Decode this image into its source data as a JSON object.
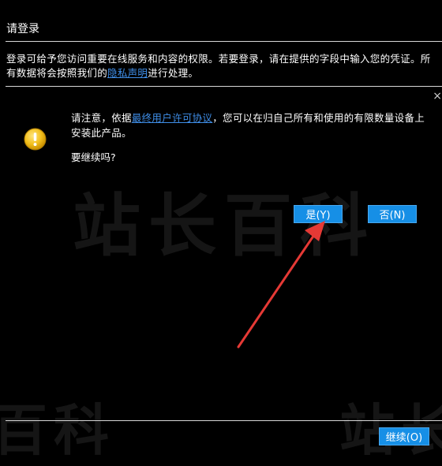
{
  "window": {
    "title": "请登录"
  },
  "intro": {
    "text_before": "登录可给予您访问重要在线服务和内容的权限。若要登录，请在提供的字段中输入您的凭证。所有数据将会按照我们的",
    "privacy_link": "隐私声明",
    "text_after": "进行处理。"
  },
  "dialog": {
    "notice_before": "请注意，依据",
    "eula_link": "最终用户许可协议",
    "notice_after": "，您可以在归自己所有和使用的有限数量设备上安装此产品。",
    "question": "要继续吗?",
    "yes_label": "是(Y)",
    "no_label": "否(N)",
    "close_glyph": "×"
  },
  "footer": {
    "continue_label": "继续(O)"
  },
  "watermark": {
    "main": "站长百科",
    "bottom_left": "百科",
    "bottom_right": "站长"
  },
  "colors": {
    "background": "#000000",
    "text": "#ffffff",
    "link": "#3f8ee8",
    "button": "#168fe6",
    "arrow": "#e53935",
    "warning_icon": "#e8b100"
  },
  "icons": {
    "warning": "warning-icon",
    "close": "close-icon",
    "annotation": "arrow-annotation"
  }
}
